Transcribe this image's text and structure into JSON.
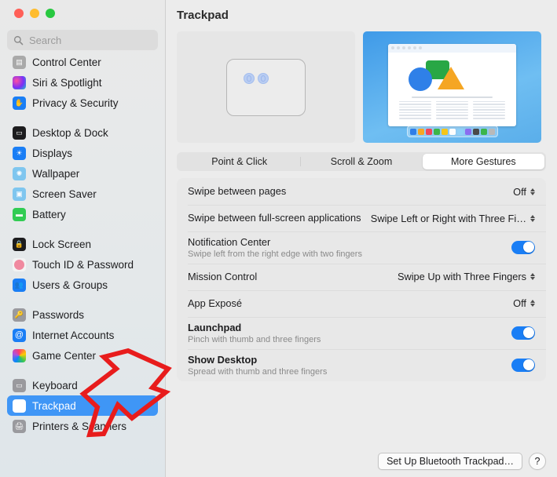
{
  "window": {
    "traffic_lights": [
      "close",
      "minimize",
      "maximize"
    ],
    "colors": {
      "accent": "#3f96f6",
      "toggle_on": "#1a7ef5",
      "annotation": "#e81c1c"
    }
  },
  "search": {
    "placeholder": "Search",
    "value": "",
    "icon": "search-icon"
  },
  "sidebar": {
    "groups": [
      {
        "items": [
          {
            "label": "Control Center",
            "icon": "control-center-icon",
            "color": "#a9a9a9",
            "selected": false
          },
          {
            "label": "Siri & Spotlight",
            "icon": "siri-icon",
            "color": "#c03a6e",
            "selected": false
          },
          {
            "label": "Privacy & Security",
            "icon": "privacy-security-icon",
            "color": "#1a7ef5",
            "selected": false
          }
        ]
      },
      {
        "items": [
          {
            "label": "Desktop & Dock",
            "icon": "desktop-dock-icon",
            "color": "#1c1c1e",
            "selected": false
          },
          {
            "label": "Displays",
            "icon": "displays-icon",
            "color": "#1a7ef5",
            "selected": false
          },
          {
            "label": "Wallpaper",
            "icon": "wallpaper-icon",
            "color": "#7fc6ef",
            "selected": false
          },
          {
            "label": "Screen Saver",
            "icon": "screen-saver-icon",
            "color": "#7fc6ef",
            "selected": false
          },
          {
            "label": "Battery",
            "icon": "battery-icon",
            "color": "#31cc53",
            "selected": false
          }
        ]
      },
      {
        "items": [
          {
            "label": "Lock Screen",
            "icon": "lock-screen-icon",
            "color": "#1c1c1e",
            "selected": false
          },
          {
            "label": "Touch ID & Password",
            "icon": "touch-id-icon",
            "color": "#f0899f",
            "selected": false
          },
          {
            "label": "Users & Groups",
            "icon": "users-groups-icon",
            "color": "#1a7ef5",
            "selected": false
          }
        ]
      },
      {
        "items": [
          {
            "label": "Passwords",
            "icon": "passwords-icon",
            "color": "#9a9a9e",
            "selected": false
          },
          {
            "label": "Internet Accounts",
            "icon": "internet-accounts-icon",
            "color": "#1a7ef5",
            "selected": false
          },
          {
            "label": "Game Center",
            "icon": "game-center-icon",
            "color": "#ffffff",
            "selected": false
          }
        ]
      },
      {
        "items": [
          {
            "label": "Keyboard",
            "icon": "keyboard-icon",
            "color": "#9a9a9e",
            "selected": false
          },
          {
            "label": "Trackpad",
            "icon": "trackpad-icon",
            "color": "#9a9a9e",
            "selected": true
          },
          {
            "label": "Printers & Scanners",
            "icon": "printers-scanners-icon",
            "color": "#9a9a9e",
            "selected": false
          }
        ]
      }
    ]
  },
  "header": {
    "title": "Trackpad"
  },
  "preview": {
    "gesture_pad": {
      "name": "trackpad-gesture-preview",
      "fingers": 2
    },
    "video": {
      "name": "gesture-video-preview"
    }
  },
  "tabs": [
    {
      "label": "Point & Click",
      "active": false
    },
    {
      "label": "Scroll & Zoom",
      "active": false
    },
    {
      "label": "More Gestures",
      "active": true
    }
  ],
  "settings": [
    {
      "name": "swipe-between-pages",
      "title": "Swipe between pages",
      "sub": "",
      "control": "popup",
      "value": "Off",
      "bold": false
    },
    {
      "name": "swipe-between-fullscreen-apps",
      "title": "Swipe between full-screen applications",
      "sub": "",
      "control": "popup",
      "value": "Swipe Left or Right with Three Fi…",
      "bold": false
    },
    {
      "name": "notification-center",
      "title": "Notification Center",
      "sub": "Swipe left from the right edge with two fingers",
      "control": "toggle",
      "value": "on",
      "bold": false
    },
    {
      "name": "mission-control",
      "title": "Mission Control",
      "sub": "",
      "control": "popup",
      "value": "Swipe Up with Three Fingers",
      "bold": false
    },
    {
      "name": "app-expose",
      "title": "App Exposé",
      "sub": "",
      "control": "popup",
      "value": "Off",
      "bold": false
    },
    {
      "name": "launchpad",
      "title": "Launchpad",
      "sub": "Pinch with thumb and three fingers",
      "control": "toggle",
      "value": "on",
      "bold": true
    },
    {
      "name": "show-desktop",
      "title": "Show Desktop",
      "sub": "Spread with thumb and three fingers",
      "control": "toggle",
      "value": "on",
      "bold": true
    }
  ],
  "footer": {
    "setup_button": "Set Up Bluetooth Trackpad…",
    "help_button": "?"
  },
  "annotation": {
    "type": "arrow",
    "points_to": "Trackpad",
    "color": "#e81c1c"
  }
}
